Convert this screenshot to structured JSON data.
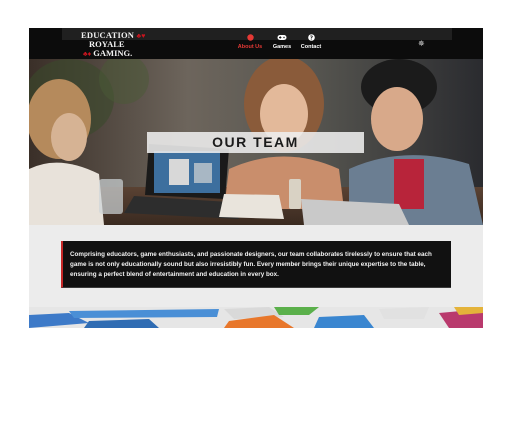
{
  "logo": {
    "line1": "EDUCATION",
    "line2": "ROYALE",
    "line3": "GAMING.",
    "suits_top": "♣♥",
    "suits_bottom": "♣♦"
  },
  "nav": {
    "items": [
      {
        "label": "About Us",
        "icon": "red-circle-icon",
        "active": true
      },
      {
        "label": "Games",
        "icon": "gamepad-icon",
        "active": false
      },
      {
        "label": "Contact",
        "icon": "question-icon",
        "active": false
      }
    ],
    "settings_icon": "gear-icon",
    "settings_glyph": "✵",
    "active_color": "#e53935"
  },
  "hero": {
    "title": "OUR TEAM"
  },
  "about": {
    "description": "Comprising educators, game enthusiasts, and passionate designers, our team collaborates tirelessly to ensure that each game is not only educationally sound but also irresistibly fun. Every member brings their unique expertise to the table, ensuring a perfect blend of entertainment and education in every box.",
    "accent_color": "#c62828"
  }
}
